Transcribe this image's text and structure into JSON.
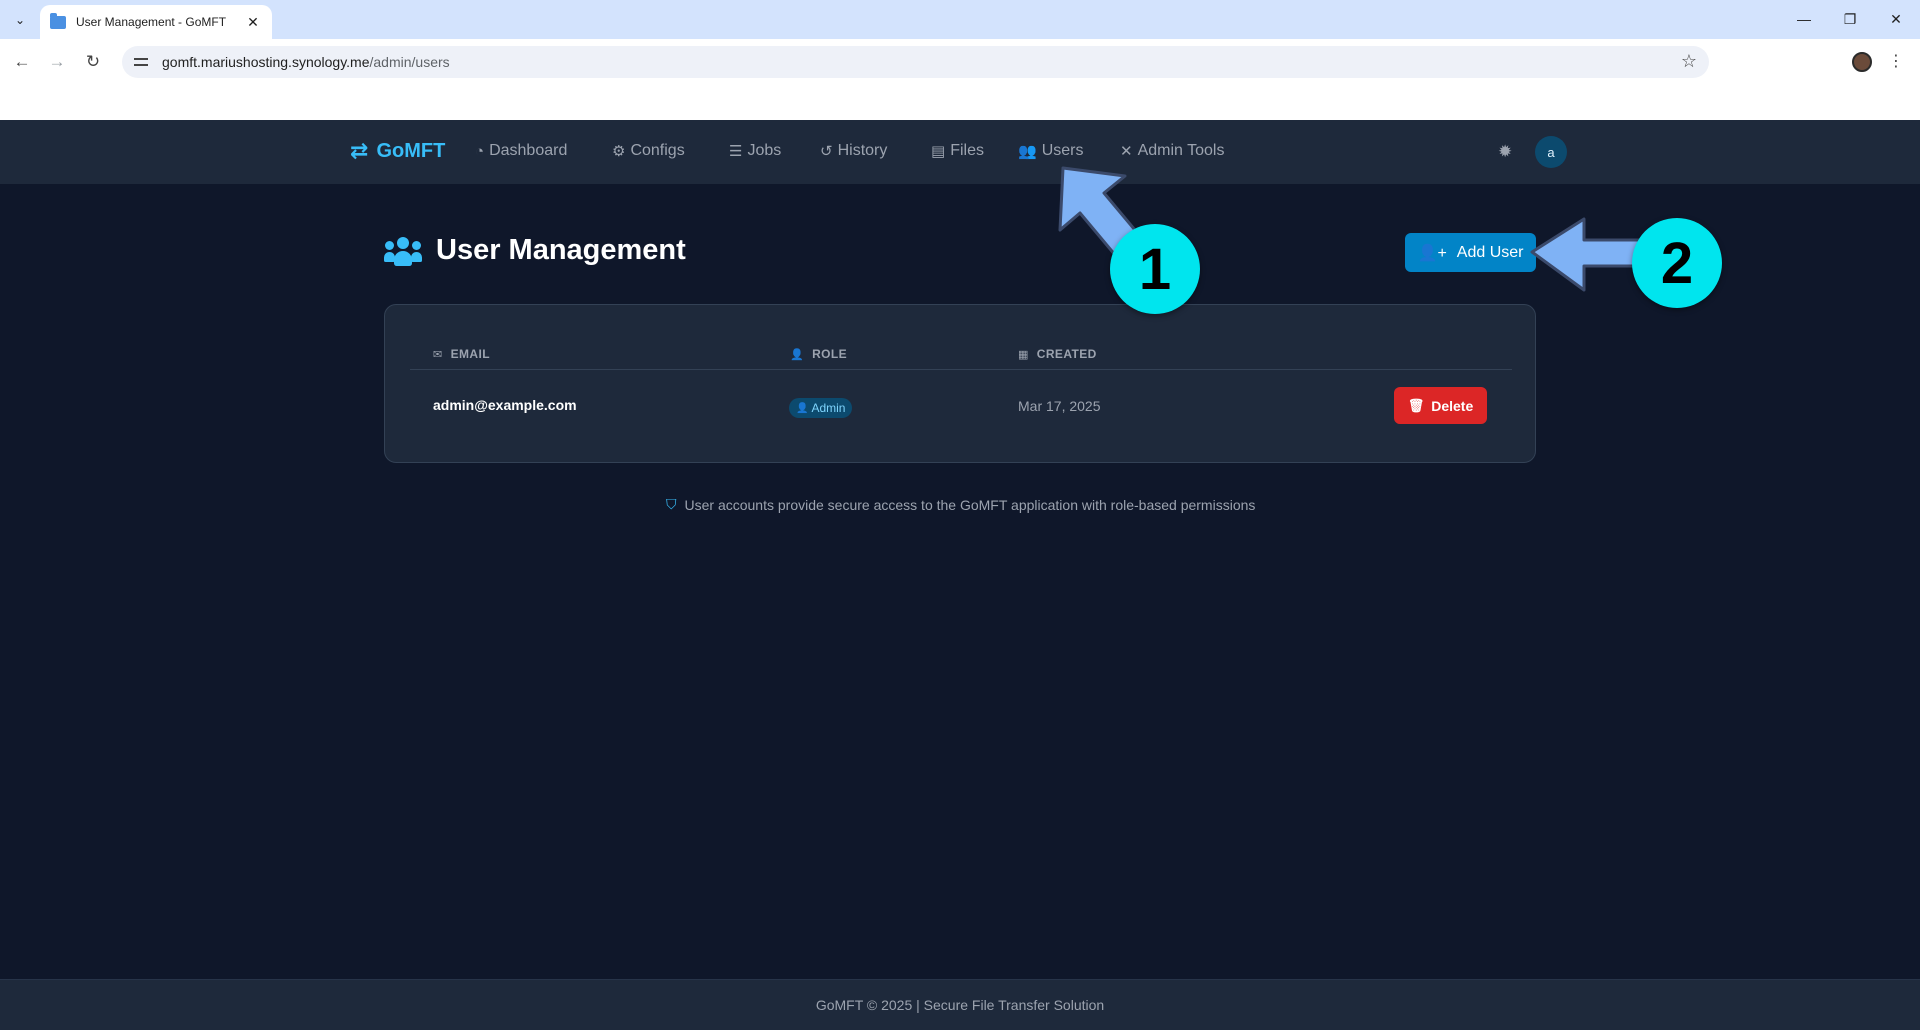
{
  "browser": {
    "tab_title": "User Management - GoMFT",
    "url_host": "gomft.mariushosting.synology.me",
    "url_path": "/admin/users"
  },
  "nav": {
    "brand": "GoMFT",
    "items": [
      {
        "label": "Dashboard",
        "icon": "gauge-icon"
      },
      {
        "label": "Configs",
        "icon": "cogs-icon"
      },
      {
        "label": "Jobs",
        "icon": "tasks-icon"
      },
      {
        "label": "History",
        "icon": "history-icon"
      },
      {
        "label": "Files",
        "icon": "file-icon"
      },
      {
        "label": "Users",
        "icon": "users-icon"
      },
      {
        "label": "Admin Tools",
        "icon": "tools-icon"
      }
    ],
    "avatar_letter": "a"
  },
  "page": {
    "title": "User Management",
    "add_user_label": "Add User"
  },
  "table": {
    "headers": {
      "email": "EMAIL",
      "role": "ROLE",
      "created": "CREATED"
    },
    "rows": [
      {
        "email": "admin@example.com",
        "role": "Admin",
        "created": "Mar 17, 2025",
        "action": "Delete"
      }
    ]
  },
  "info_note": "User accounts provide secure access to the GoMFT application with role-based permissions",
  "footer": "GoMFT © 2025 | Secure File Transfer Solution",
  "annotations": {
    "step1": "1",
    "step2": "2"
  },
  "colors": {
    "accent": "#38bdf8",
    "primary_button": "#0284c7",
    "danger": "#dc2626",
    "background": "#0f172a",
    "surface": "#1e293b",
    "annotation_badge": "#00e5ee",
    "annotation_arrow": "#7fb2f5"
  }
}
